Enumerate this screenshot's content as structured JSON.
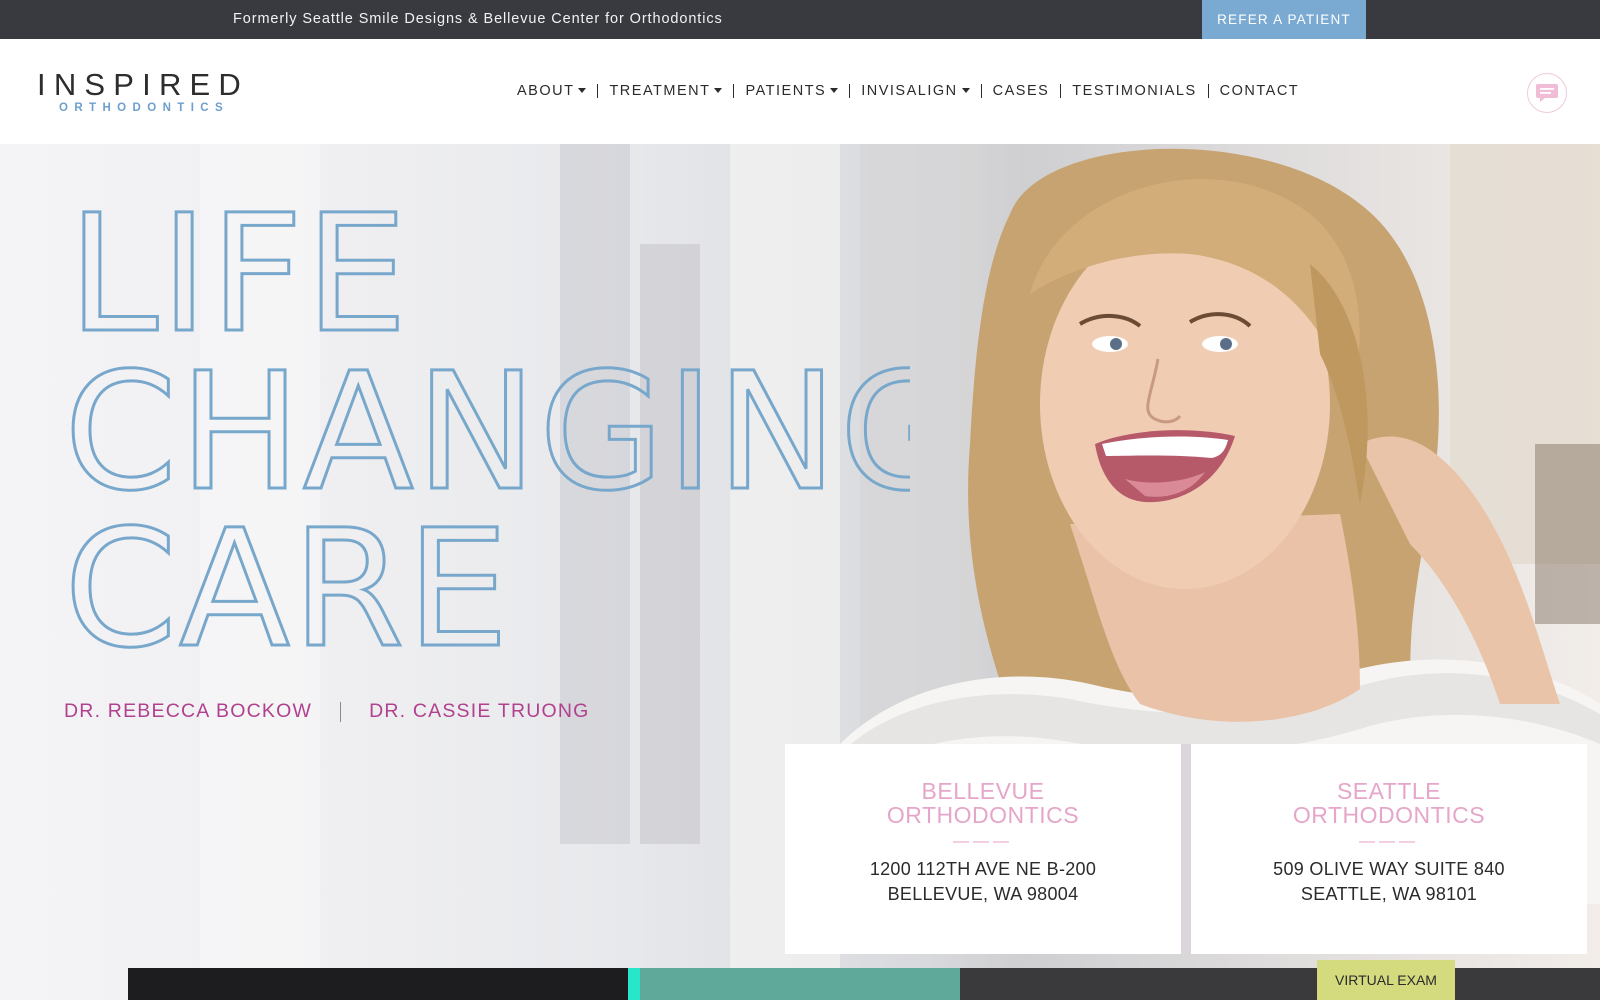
{
  "topbar": {
    "note": "Formerly Seattle Smile Designs & Bellevue Center for Orthodontics",
    "refer_label": "REFER A PATIENT"
  },
  "logo": {
    "main": "INSPIRED",
    "sub": "ORTHODONTICS"
  },
  "nav": {
    "items": [
      {
        "label": "ABOUT",
        "dropdown": true
      },
      {
        "label": "TREATMENT",
        "dropdown": true
      },
      {
        "label": "PATIENTS",
        "dropdown": true
      },
      {
        "label": "INVISALIGN",
        "dropdown": true
      },
      {
        "label": "CASES",
        "dropdown": false
      },
      {
        "label": "TESTIMONIALS",
        "dropdown": false
      },
      {
        "label": "CONTACT",
        "dropdown": false
      }
    ]
  },
  "icons": {
    "chat": "chat-bubble-icon",
    "caret": "caret-down-icon"
  },
  "hero": {
    "headline": [
      "LIFE",
      "CHANGING",
      "CARE"
    ],
    "doctors": [
      "DR. REBECCA BOCKOW",
      "DR. CASSIE TRUONG"
    ]
  },
  "locations": [
    {
      "title_1": "BELLEVUE",
      "title_2": "ORTHODONTICS",
      "divider": "———",
      "addr_1": "1200 112TH AVE NE B-200",
      "addr_2": "BELLEVUE, WA 98004"
    },
    {
      "title_1": "SEATTLE",
      "title_2": "ORTHODONTICS",
      "divider": "———",
      "addr_1": "509 OLIVE WAY SUITE 840",
      "addr_2": "SEATTLE, WA 98101"
    }
  ],
  "virtual_exam_label": "VIRTUAL EXAM",
  "colors": {
    "topbar": "#383a3f",
    "refer": "#7aaad2",
    "headline": "#78a7cc",
    "doctor_pink": "#b1418f",
    "card_title_pink": "#e5a6c9",
    "virtual_exam": "#d4db7f"
  }
}
